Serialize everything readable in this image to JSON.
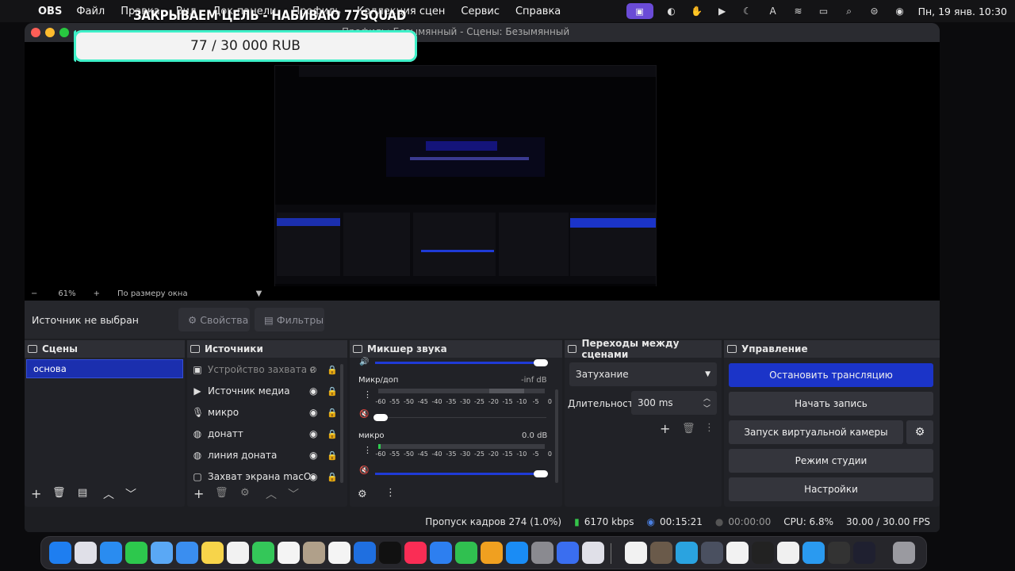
{
  "menubar": {
    "app": "OBS",
    "items": [
      "Файл",
      "Правка",
      "Вид",
      "Док-панели",
      "Профиль",
      "Коллекция сцен",
      "Сервис",
      "Справка"
    ],
    "datetime": "Пн, 19 янв.  10:30"
  },
  "overlay": {
    "title": "ЗАКРЫВАЕМ ЦЕЛЬ - НАБИВАЮ 77SQUAD",
    "progress_text": "77 / 30 000 RUB",
    "progress_fraction": 0.0026,
    "accent": "#3ef0c8"
  },
  "window": {
    "title": "Профиль: Безымянный - Сцены: Безымянный"
  },
  "zoom": {
    "minus": "−",
    "value": "61%",
    "plus": "+",
    "mode": "По размеру окна"
  },
  "source_bar": {
    "label": "Источник не выбран",
    "properties": "Свойства",
    "filters": "Фильтры"
  },
  "scenes": {
    "title": "Сцены",
    "items": [
      "основа"
    ]
  },
  "sources": {
    "title": "Источники",
    "items": [
      {
        "label": "Устройство захвата в",
        "icon": "camera-icon",
        "visible": false
      },
      {
        "label": "Источник медиа",
        "icon": "play-icon",
        "visible": true
      },
      {
        "label": "микро",
        "icon": "mic-icon",
        "visible": true
      },
      {
        "label": "донатт",
        "icon": "globe-icon",
        "visible": true
      },
      {
        "label": "линия доната",
        "icon": "globe-icon",
        "visible": true
      },
      {
        "label": "Захват экрана macO",
        "icon": "monitor-icon",
        "visible": true
      }
    ]
  },
  "mixer": {
    "title": "Микшер звука",
    "channels": [
      {
        "name": "Микр/доп",
        "db": "-inf dB"
      },
      {
        "name": "микро",
        "db": "0.0 dB"
      }
    ],
    "scale": [
      "-60",
      "-55",
      "-50",
      "-45",
      "-40",
      "-35",
      "-30",
      "-25",
      "-20",
      "-15",
      "-10",
      "-5",
      "0"
    ]
  },
  "transitions": {
    "title": "Переходы между сценами",
    "selected": "Затухание",
    "duration_label": "Длительность",
    "duration_value": "300 ms"
  },
  "controls": {
    "title": "Управление",
    "stop_stream": "Остановить трансляцию",
    "start_record": "Начать запись",
    "virtual_cam": "Запуск виртуальной камеры",
    "studio_mode": "Режим студии",
    "settings": "Настройки",
    "accent": "#1b34c8"
  },
  "status": {
    "dropped": "Пропуск кадров 274 (1.0%)",
    "bitrate": "6170 kbps",
    "stream_time": "00:15:21",
    "record_time": "00:00:00",
    "cpu": "CPU: 6.8%",
    "fps": "30.00 / 30.00 FPS"
  }
}
